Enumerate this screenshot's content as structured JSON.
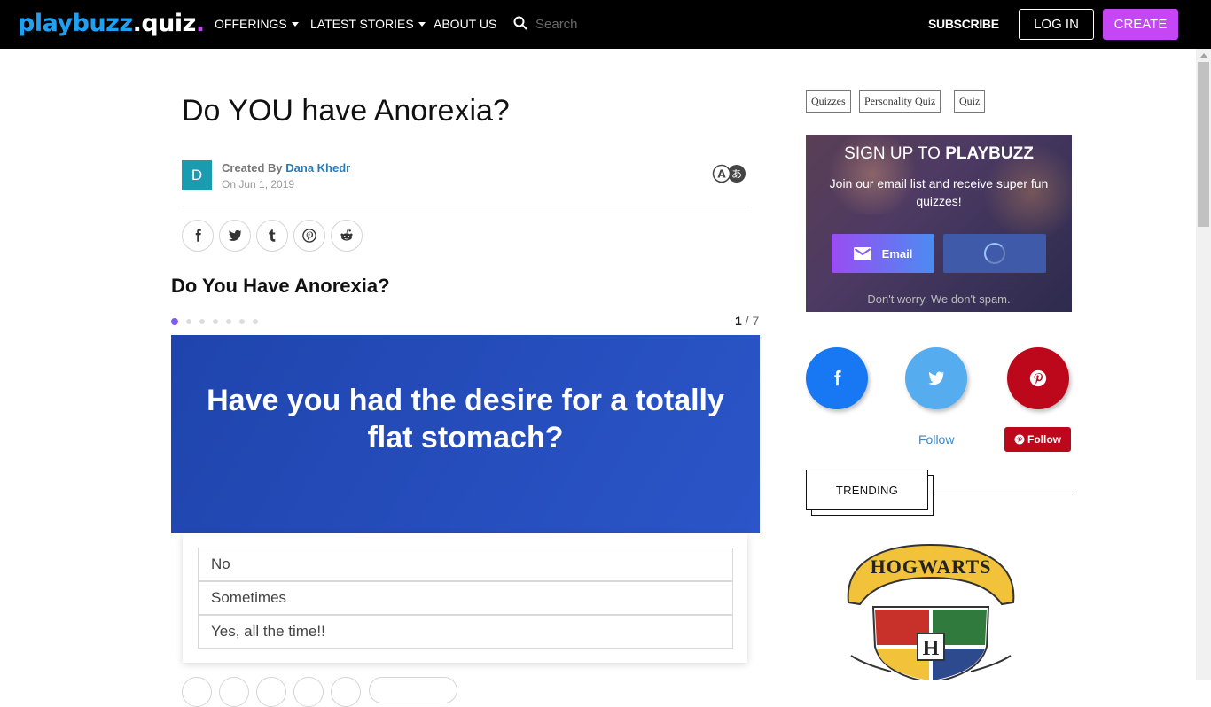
{
  "nav": {
    "logo": {
      "part1": "playbuzz",
      "part2": ".quiz",
      "dot": "."
    },
    "items": [
      {
        "label": "OFFERINGS",
        "dropdown": true
      },
      {
        "label": "LATEST STORIES",
        "dropdown": true
      },
      {
        "label": "ABOUT US",
        "dropdown": false
      }
    ],
    "search_placeholder": "Search",
    "subscribe": "SUBSCRIBE",
    "login": "LOG IN",
    "create": "CREATE"
  },
  "article": {
    "title": "Do YOU have Anorexia?",
    "avatar_letter": "D",
    "created_by": "Created By",
    "author": "Dana Khedr",
    "date": "On Jun 1, 2019",
    "share_icons": [
      "facebook-icon",
      "twitter-icon",
      "tumblr-icon",
      "pinterest-icon",
      "reddit-icon"
    ]
  },
  "quiz": {
    "title": "Do You Have Anorexia?",
    "current": "1",
    "separator": " / ",
    "total": "7",
    "step_count": 7,
    "question": "Have you had the desire for a totally flat stomach?",
    "answers": [
      "No",
      "Sometimes",
      "Yes, all the time!!"
    ]
  },
  "sidebar": {
    "tags": [
      "Quizzes",
      "Personality Quiz",
      "Quiz"
    ],
    "signup": {
      "title_prefix": "SIGN UP TO ",
      "title_brand": "PLAYBUZZ",
      "subtitle": "Join our email list and receive super fun quizzes!",
      "email_button": "Email",
      "note": "Don't worry. We don't spam."
    },
    "social": {
      "follow_text": "Follow",
      "pinterest_follow": "Follow"
    },
    "trending": "TRENDING",
    "trending_image_text": "HOGWARTS"
  },
  "colors": {
    "accent": "#c446f4",
    "logo_blue": "#1ea1f2",
    "question_bg": "#2a4fc2",
    "facebook": "#1877f2",
    "twitter": "#55acee",
    "pinterest": "#bd081c"
  }
}
